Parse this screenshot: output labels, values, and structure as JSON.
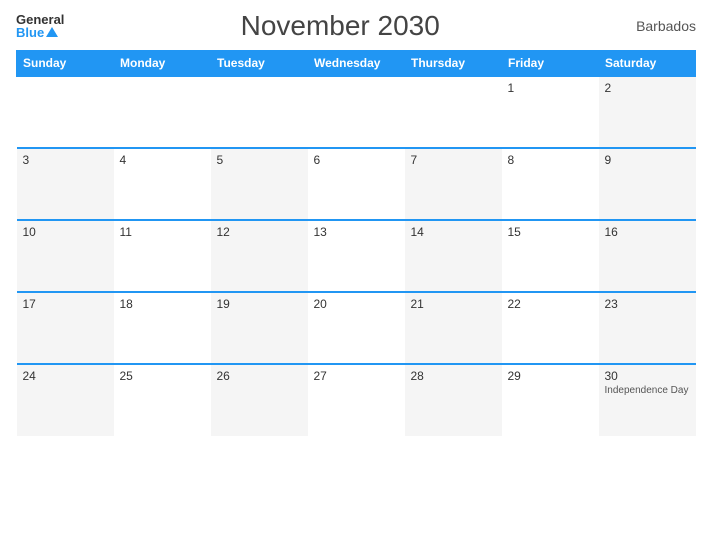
{
  "header": {
    "logo_general": "General",
    "logo_blue": "Blue",
    "title": "November 2030",
    "country": "Barbados"
  },
  "days_of_week": [
    "Sunday",
    "Monday",
    "Tuesday",
    "Wednesday",
    "Thursday",
    "Friday",
    "Saturday"
  ],
  "weeks": [
    [
      {
        "day": "",
        "event": ""
      },
      {
        "day": "",
        "event": ""
      },
      {
        "day": "",
        "event": ""
      },
      {
        "day": "",
        "event": ""
      },
      {
        "day": "",
        "event": ""
      },
      {
        "day": "1",
        "event": ""
      },
      {
        "day": "2",
        "event": ""
      }
    ],
    [
      {
        "day": "3",
        "event": ""
      },
      {
        "day": "4",
        "event": ""
      },
      {
        "day": "5",
        "event": ""
      },
      {
        "day": "6",
        "event": ""
      },
      {
        "day": "7",
        "event": ""
      },
      {
        "day": "8",
        "event": ""
      },
      {
        "day": "9",
        "event": ""
      }
    ],
    [
      {
        "day": "10",
        "event": ""
      },
      {
        "day": "11",
        "event": ""
      },
      {
        "day": "12",
        "event": ""
      },
      {
        "day": "13",
        "event": ""
      },
      {
        "day": "14",
        "event": ""
      },
      {
        "day": "15",
        "event": ""
      },
      {
        "day": "16",
        "event": ""
      }
    ],
    [
      {
        "day": "17",
        "event": ""
      },
      {
        "day": "18",
        "event": ""
      },
      {
        "day": "19",
        "event": ""
      },
      {
        "day": "20",
        "event": ""
      },
      {
        "day": "21",
        "event": ""
      },
      {
        "day": "22",
        "event": ""
      },
      {
        "day": "23",
        "event": ""
      }
    ],
    [
      {
        "day": "24",
        "event": ""
      },
      {
        "day": "25",
        "event": ""
      },
      {
        "day": "26",
        "event": ""
      },
      {
        "day": "27",
        "event": ""
      },
      {
        "day": "28",
        "event": ""
      },
      {
        "day": "29",
        "event": ""
      },
      {
        "day": "30",
        "event": "Independence Day"
      }
    ]
  ]
}
